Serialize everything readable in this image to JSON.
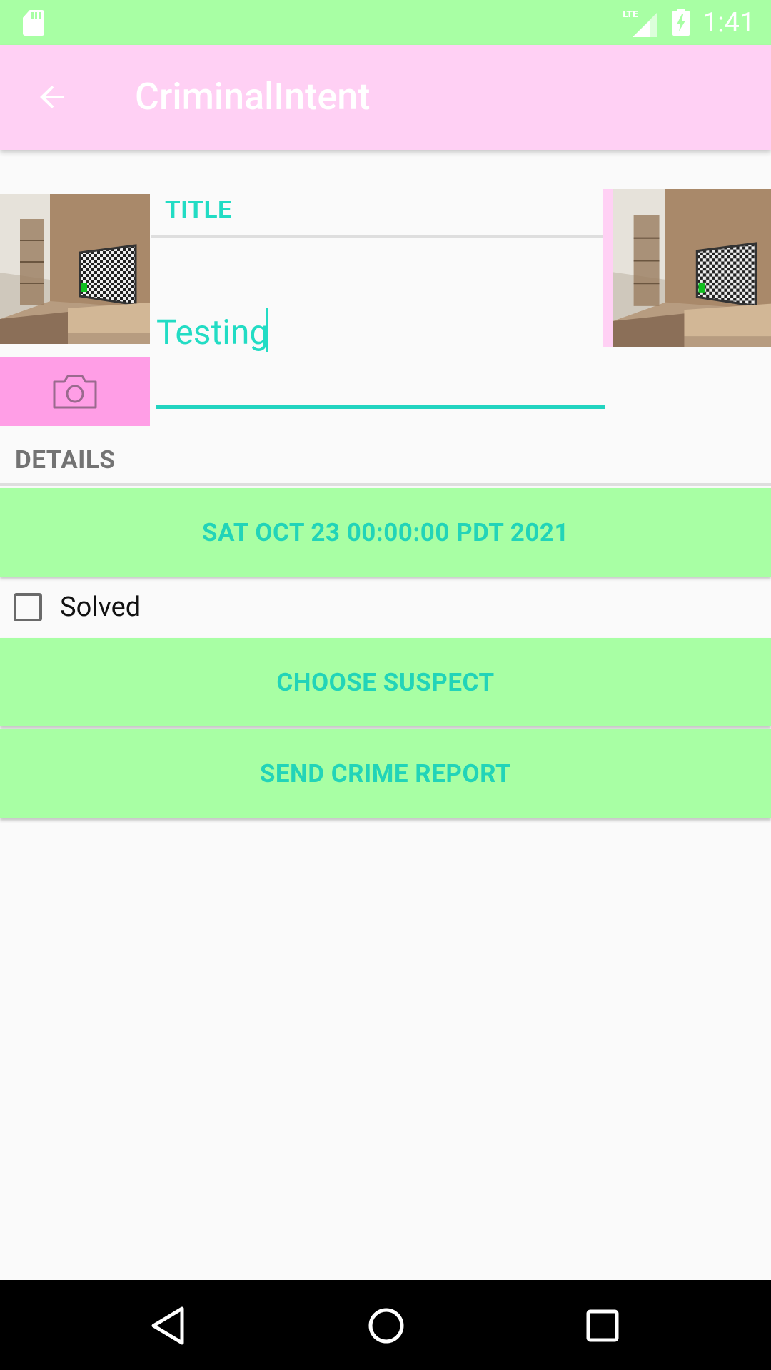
{
  "status_bar": {
    "time": "1:41",
    "network_label": "LTE",
    "icons": [
      "sd-card-icon",
      "lte-signal-icon",
      "battery-charging-icon"
    ]
  },
  "app_bar": {
    "title": "CriminalIntent",
    "back_icon": "arrow-back-icon",
    "background_color": "#ffd0f4"
  },
  "crime": {
    "photo_icon": "camera-icon",
    "title_label": "TITLE",
    "title_value": "Testing",
    "details_label": "DETAILS",
    "date_button": "SAT OCT 23 00:00:00 PDT 2021",
    "solved_label": "Solved",
    "solved": false,
    "choose_suspect": "CHOOSE SUSPECT",
    "send_report": "SEND CRIME REPORT"
  },
  "colors": {
    "status_bar": "#a8ffa4",
    "accent": "#22dcc4",
    "button_bg": "#a8ffa4",
    "camera_button": "#ff9ee6"
  },
  "nav_bar": {
    "icons": [
      "nav-back-icon",
      "nav-home-icon",
      "nav-recents-icon"
    ]
  }
}
